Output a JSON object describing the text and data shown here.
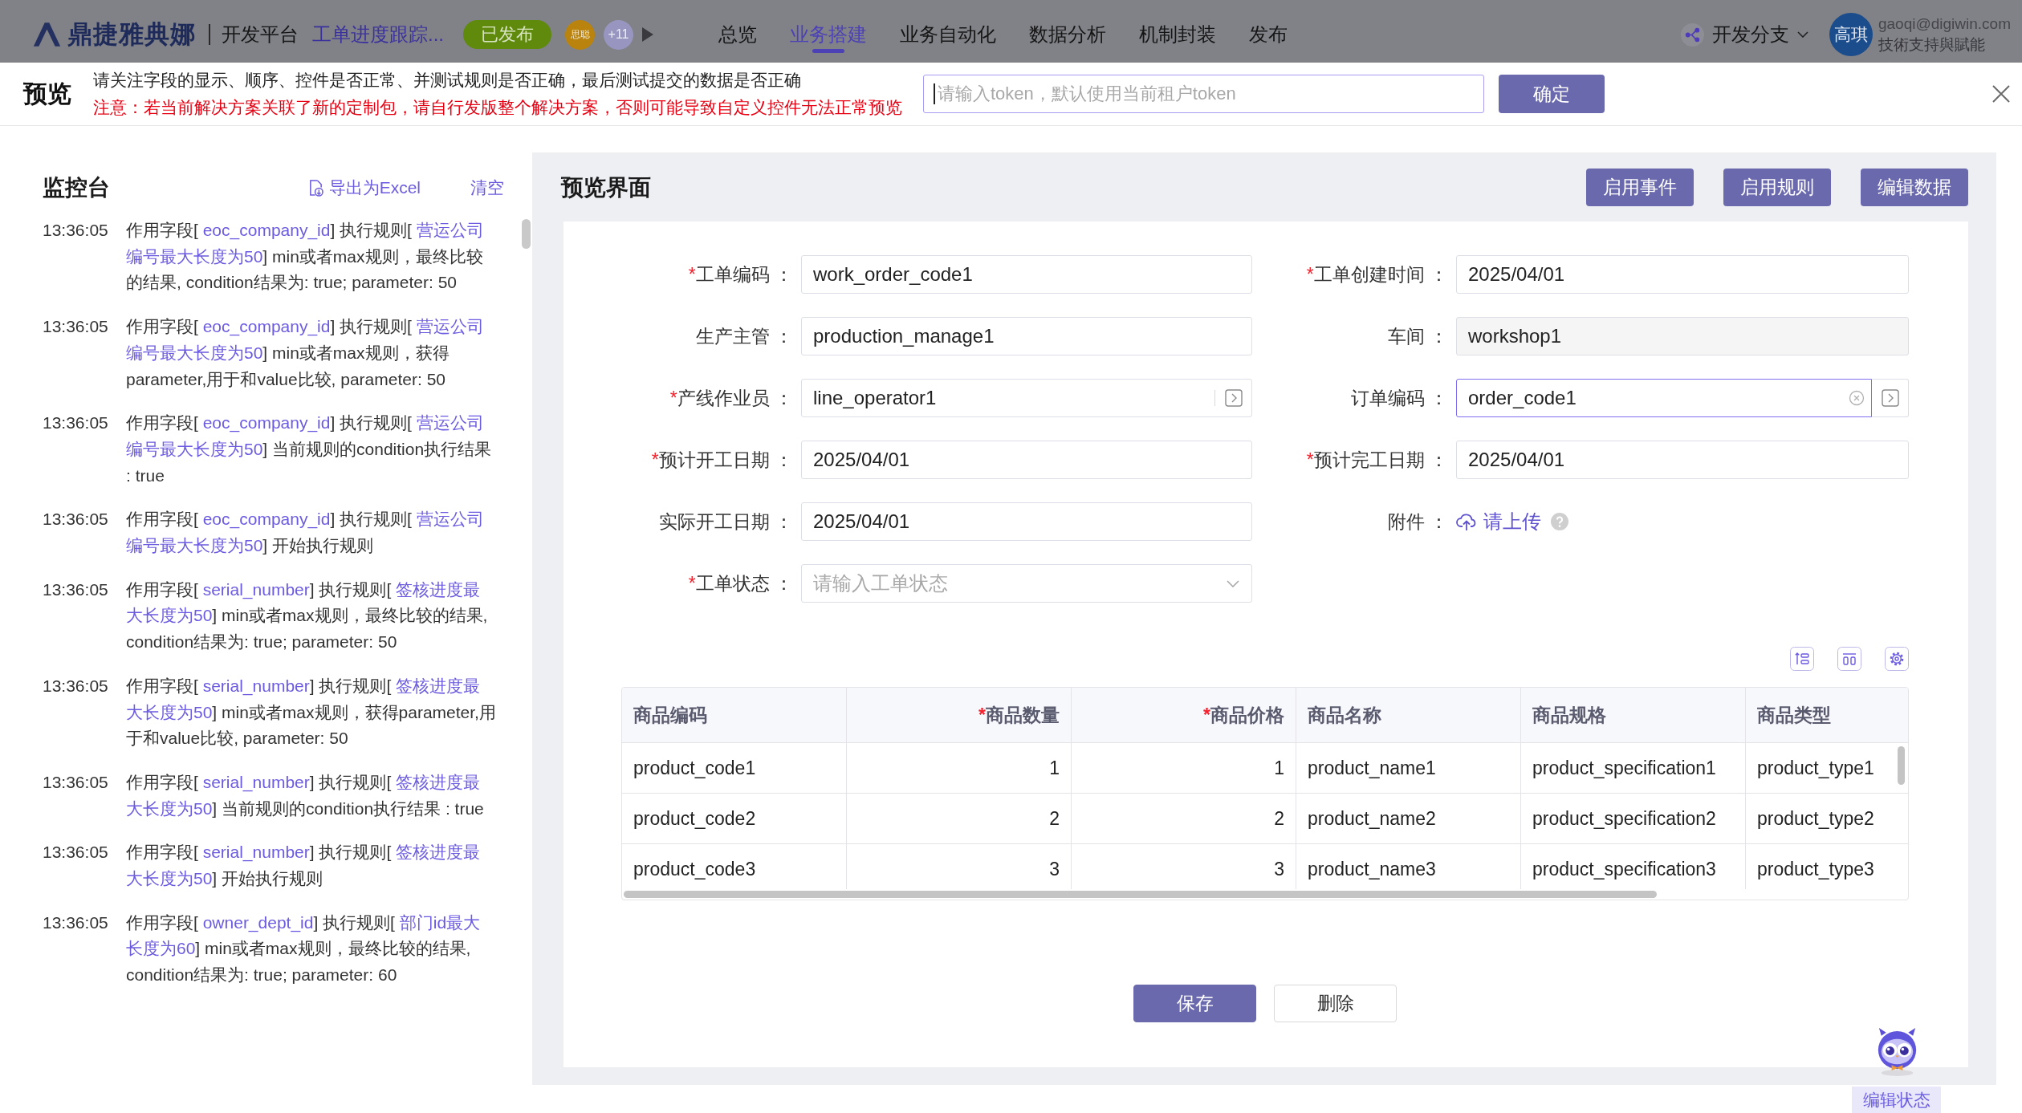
{
  "header": {
    "logo": "鼎捷雅典娜",
    "platform": "开发平台",
    "app_name": "工单进度跟踪...",
    "status": "已发布",
    "collaborators": [
      {
        "name": "思聪"
      }
    ],
    "more_count": "+11",
    "nav": [
      {
        "label": "总览",
        "selected": false
      },
      {
        "label": "业务搭建",
        "selected": true
      },
      {
        "label": "业务自动化",
        "selected": false
      },
      {
        "label": "数据分析",
        "selected": false
      },
      {
        "label": "机制封装",
        "selected": false
      },
      {
        "label": "发布",
        "selected": false
      }
    ],
    "branch": "开发分支",
    "user": {
      "avatar": "高琪",
      "email": "gaoqi@digiwin.com",
      "org": "技術支持與賦能"
    }
  },
  "preview_bar": {
    "title": "预览",
    "notice": "请关注字段的显示、顺序、控件是否正常、并测试规则是否正确，最后测试提交的数据是否正确",
    "warning": "注意：若当前解决方案关联了新的定制包，请自行发版整个解决方案，否则可能导致自定义控件无法正常预览",
    "token_field": {
      "placeholder": "请输入token，默认使用当前租户token",
      "focused": true
    },
    "confirm": "确定"
  },
  "console": {
    "title": "监控台",
    "export": "导出为Excel",
    "clear": "清空",
    "entries": [
      {
        "time": "13:36:05",
        "segments": [
          {
            "text": "作用字段[ ",
            "highlighted": false
          },
          {
            "text": "eoc_company_id",
            "highlighted": true
          },
          {
            "text": "] 执行规则[ ",
            "highlighted": false
          },
          {
            "text": "营运公司编号最大长度为50",
            "highlighted": true
          },
          {
            "text": "] min或者max规则，最终比较的结果, condition结果为: true; parameter: 50",
            "highlighted": false
          }
        ]
      },
      {
        "time": "13:36:05",
        "segments": [
          {
            "text": "作用字段[ ",
            "highlighted": false
          },
          {
            "text": "eoc_company_id",
            "highlighted": true
          },
          {
            "text": "] 执行规则[ ",
            "highlighted": false
          },
          {
            "text": "营运公司编号最大长度为50",
            "highlighted": true
          },
          {
            "text": "] min或者max规则，获得parameter,用于和value比较, parameter: 50",
            "highlighted": false
          }
        ]
      },
      {
        "time": "13:36:05",
        "segments": [
          {
            "text": "作用字段[ ",
            "highlighted": false
          },
          {
            "text": "eoc_company_id",
            "highlighted": true
          },
          {
            "text": "] 执行规则[ ",
            "highlighted": false
          },
          {
            "text": "营运公司编号最大长度为50",
            "highlighted": true
          },
          {
            "text": "] 当前规则的condition执行结果 : true",
            "highlighted": false
          }
        ]
      },
      {
        "time": "13:36:05",
        "segments": [
          {
            "text": "作用字段[ ",
            "highlighted": false
          },
          {
            "text": "eoc_company_id",
            "highlighted": true
          },
          {
            "text": "] 执行规则[ ",
            "highlighted": false
          },
          {
            "text": "营运公司编号最大长度为50",
            "highlighted": true
          },
          {
            "text": "] 开始执行规则",
            "highlighted": false
          }
        ]
      },
      {
        "time": "13:36:05",
        "segments": [
          {
            "text": "作用字段[ ",
            "highlighted": false
          },
          {
            "text": "serial_number",
            "highlighted": true
          },
          {
            "text": "] 执行规则[ ",
            "highlighted": false
          },
          {
            "text": "签核进度最大长度为50",
            "highlighted": true
          },
          {
            "text": "] min或者max规则，最终比较的结果, condition结果为: true; parameter: 50",
            "highlighted": false
          }
        ]
      },
      {
        "time": "13:36:05",
        "segments": [
          {
            "text": "作用字段[ ",
            "highlighted": false
          },
          {
            "text": "serial_number",
            "highlighted": true
          },
          {
            "text": "] 执行规则[ ",
            "highlighted": false
          },
          {
            "text": "签核进度最大长度为50",
            "highlighted": true
          },
          {
            "text": "] min或者max规则，获得parameter,用于和value比较, parameter: 50",
            "highlighted": false
          }
        ]
      },
      {
        "time": "13:36:05",
        "segments": [
          {
            "text": "作用字段[ ",
            "highlighted": false
          },
          {
            "text": "serial_number",
            "highlighted": true
          },
          {
            "text": "] 执行规则[ ",
            "highlighted": false
          },
          {
            "text": "签核进度最大长度为50",
            "highlighted": true
          },
          {
            "text": "] 当前规则的condition执行结果 : true",
            "highlighted": false
          }
        ]
      },
      {
        "time": "13:36:05",
        "segments": [
          {
            "text": "作用字段[ ",
            "highlighted": false
          },
          {
            "text": "serial_number",
            "highlighted": true
          },
          {
            "text": "] 执行规则[ ",
            "highlighted": false
          },
          {
            "text": "签核进度最大长度为50",
            "highlighted": true
          },
          {
            "text": "] 开始执行规则",
            "highlighted": false
          }
        ]
      },
      {
        "time": "13:36:05",
        "segments": [
          {
            "text": "作用字段[ ",
            "highlighted": false
          },
          {
            "text": "owner_dept_id",
            "highlighted": true
          },
          {
            "text": "] 执行规则[ ",
            "highlighted": false
          },
          {
            "text": "部门id最大长度为60",
            "highlighted": true
          },
          {
            "text": "] min或者max规则，最终比较的结果, condition结果为: true; parameter: 60",
            "highlighted": false
          }
        ]
      }
    ]
  },
  "preview": {
    "title": "预览界面",
    "actions": [
      "启用事件",
      "启用规则",
      "编辑数据"
    ],
    "form": {
      "fields": [
        {
          "kind": "text",
          "label": "工单编码 ：",
          "required_mark": "*",
          "value": "work_order_code1",
          "focused": false
        },
        {
          "kind": "text",
          "label": "工单创建时间 ：",
          "required_mark": "*",
          "value": "2025/04/01",
          "focused": false
        },
        {
          "kind": "text",
          "label": "生产主管 ：",
          "value": "production_manage1",
          "focused": false
        },
        {
          "kind": "readonly",
          "label": "车间 ：",
          "value": "workshop1",
          "focused": false
        },
        {
          "kind": "picker",
          "label": "产线作业员 ：",
          "required_mark": "*",
          "value": "line_operator1",
          "focused": false
        },
        {
          "kind": "lookup",
          "label": "订单编码 ：",
          "value": "order_code1",
          "focused": true
        },
        {
          "kind": "text",
          "label": "预计开工日期 ：",
          "required_mark": "*",
          "value": "2025/04/01",
          "focused": false
        },
        {
          "kind": "text",
          "label": "预计完工日期 ：",
          "required_mark": "*",
          "value": "2025/04/01",
          "focused": false
        },
        {
          "kind": "text",
          "label": "实际开工日期 ：",
          "value": "2025/04/01",
          "focused": false
        },
        {
          "kind": "upload",
          "label": "附件 ：",
          "action": "请上传",
          "focused": false
        },
        {
          "kind": "select",
          "label": "工单状态 ：",
          "required_mark": "*",
          "placeholder": "请输入工单状态",
          "focused": false
        }
      ]
    },
    "table": {
      "columns": [
        {
          "label": "商品编码",
          "kind": "text"
        },
        {
          "label": "商品数量",
          "kind": "number",
          "required_mark": "*"
        },
        {
          "label": "商品价格",
          "kind": "number",
          "required_mark": "*"
        },
        {
          "label": "商品名称",
          "kind": "text"
        },
        {
          "label": "商品规格",
          "kind": "text"
        },
        {
          "label": "商品类型",
          "kind": "text"
        }
      ],
      "rows": [
        [
          "product_code1",
          "1",
          "1",
          "product_name1",
          "product_specification1",
          "product_type1"
        ],
        [
          "product_code2",
          "2",
          "2",
          "product_name2",
          "product_specification2",
          "product_type2"
        ],
        [
          "product_code3",
          "3",
          "3",
          "product_name3",
          "product_specification3",
          "product_type3"
        ]
      ]
    },
    "buttons": [
      {
        "label": "保存",
        "kind": "primary"
      },
      {
        "label": "删除",
        "kind": "default"
      }
    ]
  },
  "assistant": {
    "status": "编辑状态"
  }
}
